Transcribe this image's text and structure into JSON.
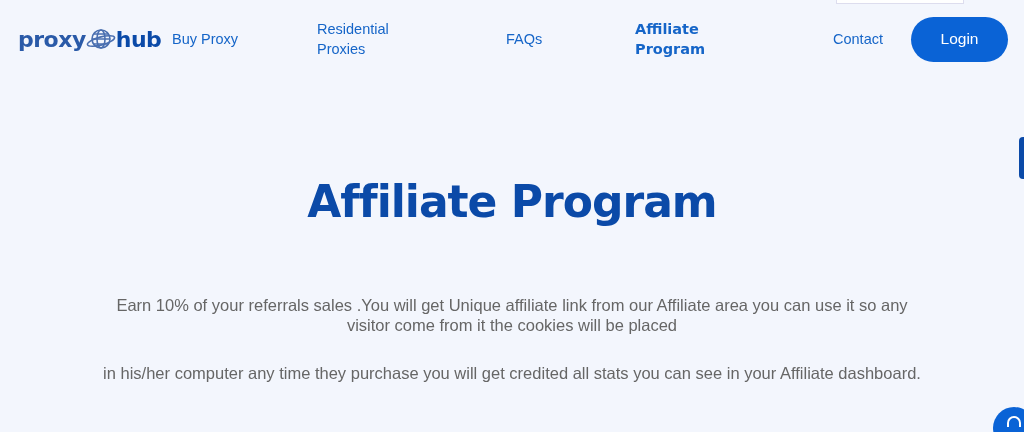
{
  "header": {
    "logo": {
      "left": "proxy",
      "right": "hub"
    },
    "nav": [
      {
        "label": "Buy Proxy",
        "selected": false
      },
      {
        "label": "Residential Proxies",
        "selected": false
      },
      {
        "label": "FAQs",
        "selected": false
      },
      {
        "label": "Affiliate Program",
        "selected": true
      },
      {
        "label": "Contact",
        "selected": false
      }
    ],
    "login": "Login"
  },
  "title": "Affiliate Program",
  "paragraphs": [
    "Earn 10% of your referrals sales .You will get Unique affiliate link from our Affiliate area you can use it so any visitor come from it the cookies will be placed",
    "in his/her computer any time they purchase you will get credited all stats you can see in your Affiliate dashboard."
  ]
}
